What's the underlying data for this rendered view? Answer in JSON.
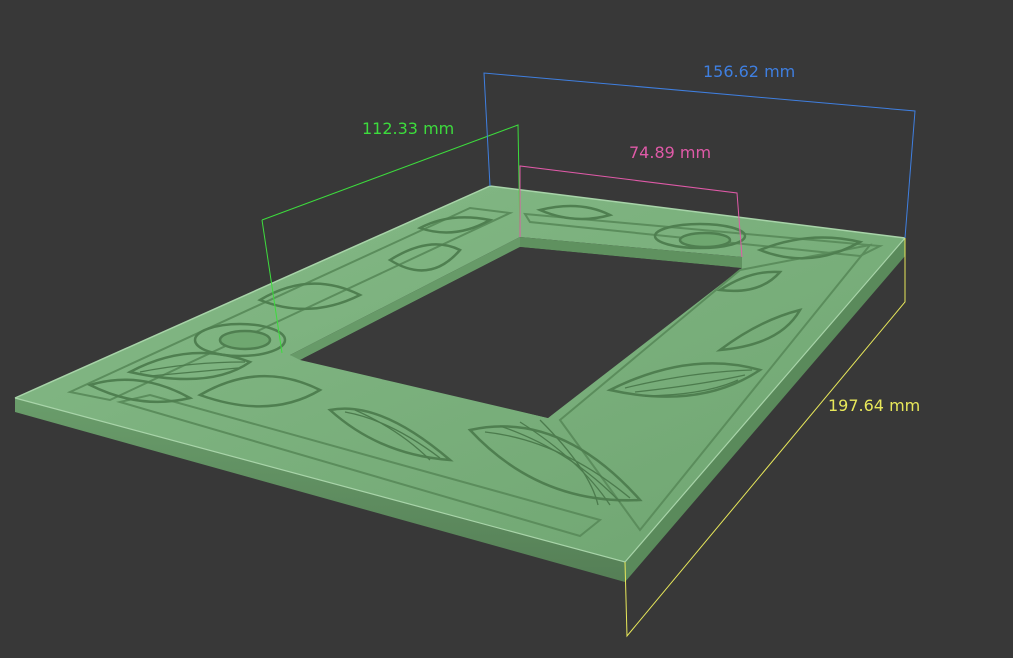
{
  "viewport": {
    "background": "#383838"
  },
  "model": {
    "description_color": "#6fa870",
    "face_color": "#7fb381",
    "side_color": "#5f9160"
  },
  "dimensions": [
    {
      "id": "depth",
      "label": "112.33 mm",
      "color": "#3ddc3d"
    },
    {
      "id": "width",
      "label": "156.62 mm",
      "color": "#3f7fe0"
    },
    {
      "id": "inner",
      "label": "74.89 mm",
      "color": "#e05aa8"
    },
    {
      "id": "length",
      "label": "197.64 mm",
      "color": "#e8e85a"
    }
  ]
}
